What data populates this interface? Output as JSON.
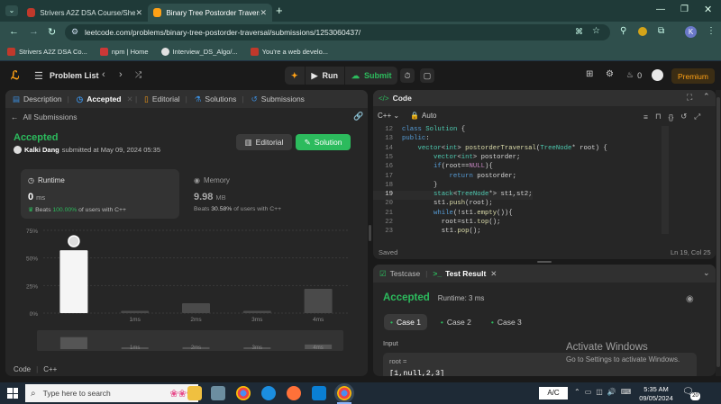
{
  "browser": {
    "tabs": [
      {
        "label": "Strivers A2Z DSA Course/Sheet",
        "active": false
      },
      {
        "label": "Binary Tree Postorder Traversal",
        "active": true
      }
    ],
    "url": "leetcode.com/problems/binary-tree-postorder-traversal/submissions/1253060437/",
    "profile_initial": "K",
    "bookmarks": [
      "Strivers A2Z DSA Co...",
      "npm | Home",
      "Interview_DS_Algo/...",
      "You're a web develo..."
    ]
  },
  "lc_nav": {
    "problem_list": "Problem List",
    "run": "Run",
    "submit": "Submit",
    "coins": "0",
    "premium": "Premium"
  },
  "left": {
    "tabs": [
      "Description",
      "Accepted",
      "Editorial",
      "Solutions",
      "Submissions"
    ],
    "back_link": "All Submissions",
    "status": "Accepted",
    "author": "Kalki Dang",
    "submitted_text": "submitted at May 09, 2024 05:35",
    "editorial_btn": "Editorial",
    "solution_btn": "Solution",
    "runtime_label": "Runtime",
    "runtime_value": "0",
    "runtime_unit": "ms",
    "runtime_beats_prefix": "Beats",
    "runtime_beats": "100.00%",
    "runtime_beats_suffix": "of users with C++",
    "memory_label": "Memory",
    "memory_value": "9.98",
    "memory_unit": "MB",
    "memory_beats_prefix": "Beats",
    "memory_beats": "30.58%",
    "memory_beats_suffix": "of users with C++",
    "code_label": "Code",
    "code_lang": "C++"
  },
  "chart_data": {
    "type": "bar",
    "categories": [
      "",
      "1ms",
      "2ms",
      "3ms",
      "4ms"
    ],
    "values": [
      57,
      2,
      9,
      2,
      22
    ],
    "ytick_labels": [
      "75%",
      "50%",
      "25%",
      "0%"
    ],
    "ylim": [
      0,
      75
    ],
    "highlight_index": 0,
    "overview_labels": [
      "1ms",
      "2ms",
      "3ms",
      "4ms"
    ]
  },
  "code": {
    "title": "Code",
    "lang": "C++",
    "mode": "Auto",
    "lines": [
      {
        "n": "12",
        "text": "class Solution {"
      },
      {
        "n": "13",
        "text": "public:"
      },
      {
        "n": "14",
        "text": "    vector<int> postorderTraversal(TreeNode* root) {"
      },
      {
        "n": "15",
        "text": "        vector<int> postorder;"
      },
      {
        "n": "16",
        "text": "        if(root==NULL){"
      },
      {
        "n": "17",
        "text": "            return postorder;"
      },
      {
        "n": "18",
        "text": "        }"
      },
      {
        "n": "19",
        "text": "        stack<TreeNode*> st1,st2;"
      },
      {
        "n": "20",
        "text": "        st1.push(root);"
      },
      {
        "n": "21",
        "text": "        while(!st1.empty()){"
      },
      {
        "n": "22",
        "text": "          root=st1.top();"
      },
      {
        "n": "23",
        "text": "          st1.pop();"
      }
    ],
    "saved": "Saved",
    "cursor": "Ln 19, Col 25"
  },
  "test": {
    "tab_testcase": "Testcase",
    "tab_result": "Test Result",
    "status": "Accepted",
    "runtime": "Runtime: 3 ms",
    "cases": [
      "Case 1",
      "Case 2",
      "Case 3"
    ],
    "input_label": "Input",
    "var_name": "root =",
    "var_value": "[1,null,2,3]"
  },
  "watermark": {
    "title": "Activate Windows",
    "subtitle": "Go to Settings to activate Windows."
  },
  "taskbar": {
    "search_placeholder": "Type here to search",
    "ime": "A/C",
    "time": "5:35 AM",
    "date": "09/05/2024",
    "notif_count": "20"
  },
  "colors": {
    "accent_green": "#2cbb5d",
    "leetcode_orange": "#ffa116",
    "browser_teal": "#2f4f4c"
  }
}
